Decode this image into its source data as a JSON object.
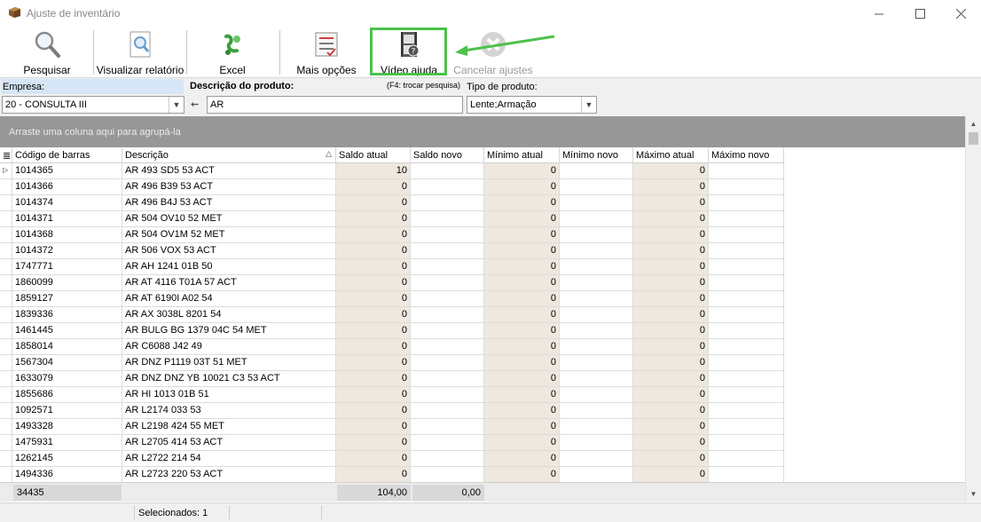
{
  "window": {
    "title": "Ajuste de inventário"
  },
  "toolbar": {
    "buttons": [
      {
        "label": "Pesquisar",
        "icon": "magnifier-icon"
      },
      {
        "label": "Visualizar relatório",
        "icon": "report-preview-icon"
      },
      {
        "label": "Excel",
        "icon": "excel-icon"
      },
      {
        "label": "Mais opções",
        "icon": "checklist-icon"
      },
      {
        "label": "Vídeo ajuda",
        "icon": "video-help-icon"
      },
      {
        "label": "Cancelar ajustes",
        "icon": "cancel-icon"
      }
    ]
  },
  "filters": {
    "empresa_label": "Empresa:",
    "empresa_value": "20 - CONSULTA III",
    "descricao_label": "Descrição do produto:",
    "descricao_hint": "(F4: trocar pesquisa)",
    "descricao_value": "AR",
    "tipo_label": "Tipo de produto:",
    "tipo_value": "Lente;Armação"
  },
  "group_panel": {
    "text": "Arraste uma coluna aqui para agrupá-la"
  },
  "grid": {
    "columns": [
      "Código de barras",
      "Descrição",
      "Saldo atual",
      "Saldo novo",
      "Mínimo atual",
      "Mínimo novo",
      "Máximo atual",
      "Máximo novo"
    ],
    "rows": [
      {
        "codigo": "1014365",
        "descricao": "AR  493 SD5 53 ACT",
        "saldo_atual": "10",
        "minimo_atual": "0",
        "maximo_atual": "0"
      },
      {
        "codigo": "1014366",
        "descricao": "AR  496 B39 53 ACT",
        "saldo_atual": "0",
        "minimo_atual": "0",
        "maximo_atual": "0"
      },
      {
        "codigo": "1014374",
        "descricao": "AR  496 B4J 53 ACT",
        "saldo_atual": "0",
        "minimo_atual": "0",
        "maximo_atual": "0"
      },
      {
        "codigo": "1014371",
        "descricao": "AR  504 OV10 52 MET",
        "saldo_atual": "0",
        "minimo_atual": "0",
        "maximo_atual": "0"
      },
      {
        "codigo": "1014368",
        "descricao": "AR  504 OV1M 52 MET",
        "saldo_atual": "0",
        "minimo_atual": "0",
        "maximo_atual": "0"
      },
      {
        "codigo": "1014372",
        "descricao": "AR  506 VOX 53 ACT",
        "saldo_atual": "0",
        "minimo_atual": "0",
        "maximo_atual": "0"
      },
      {
        "codigo": "1747771",
        "descricao": "AR  AH 1241 01B 50",
        "saldo_atual": "0",
        "minimo_atual": "0",
        "maximo_atual": "0"
      },
      {
        "codigo": "1860099",
        "descricao": "AR  AT 4116 T01A 57  ACT",
        "saldo_atual": "0",
        "minimo_atual": "0",
        "maximo_atual": "0"
      },
      {
        "codigo": "1859127",
        "descricao": "AR  AT 6190I A02 54",
        "saldo_atual": "0",
        "minimo_atual": "0",
        "maximo_atual": "0"
      },
      {
        "codigo": "1839336",
        "descricao": "AR  AX 3038L 8201 54",
        "saldo_atual": "0",
        "minimo_atual": "0",
        "maximo_atual": "0"
      },
      {
        "codigo": "1461445",
        "descricao": "AR  BULG BG 1379 04C 54 MET",
        "saldo_atual": "0",
        "minimo_atual": "0",
        "maximo_atual": "0"
      },
      {
        "codigo": "1858014",
        "descricao": "AR  C6088 J42 49",
        "saldo_atual": "0",
        "minimo_atual": "0",
        "maximo_atual": "0"
      },
      {
        "codigo": "1567304",
        "descricao": "AR  DNZ  P1119 03T 51 MET",
        "saldo_atual": "0",
        "minimo_atual": "0",
        "maximo_atual": "0"
      },
      {
        "codigo": "1633079",
        "descricao": "AR  DNZ DNZ YB 10021 C3 53 ACT",
        "saldo_atual": "0",
        "minimo_atual": "0",
        "maximo_atual": "0"
      },
      {
        "codigo": "1855686",
        "descricao": "AR  HI 1013 01B 51",
        "saldo_atual": "0",
        "minimo_atual": "0",
        "maximo_atual": "0"
      },
      {
        "codigo": "1092571",
        "descricao": "AR  L2174 033 53",
        "saldo_atual": "0",
        "minimo_atual": "0",
        "maximo_atual": "0"
      },
      {
        "codigo": "1493328",
        "descricao": "AR  L2198 424 55 MET",
        "saldo_atual": "0",
        "minimo_atual": "0",
        "maximo_atual": "0"
      },
      {
        "codigo": "1475931",
        "descricao": "AR  L2705 414 53 ACT",
        "saldo_atual": "0",
        "minimo_atual": "0",
        "maximo_atual": "0"
      },
      {
        "codigo": "1262145",
        "descricao": "AR  L2722 214 54",
        "saldo_atual": "0",
        "minimo_atual": "0",
        "maximo_atual": "0"
      },
      {
        "codigo": "1494336",
        "descricao": "AR  L2723 220 53 ACT",
        "saldo_atual": "0",
        "minimo_atual": "0",
        "maximo_atual": "0"
      }
    ],
    "footer": {
      "count": "34435",
      "saldo_atual_total": "104,00",
      "saldo_novo_total": "0,00"
    }
  },
  "status": {
    "selecionados": "Selecionados: 1"
  },
  "colors": {
    "highlight": "#4cc24c",
    "readonly_cell": "#efe8df",
    "group_panel": "#979797",
    "empresa_label_bg": "#d6e6f6"
  }
}
